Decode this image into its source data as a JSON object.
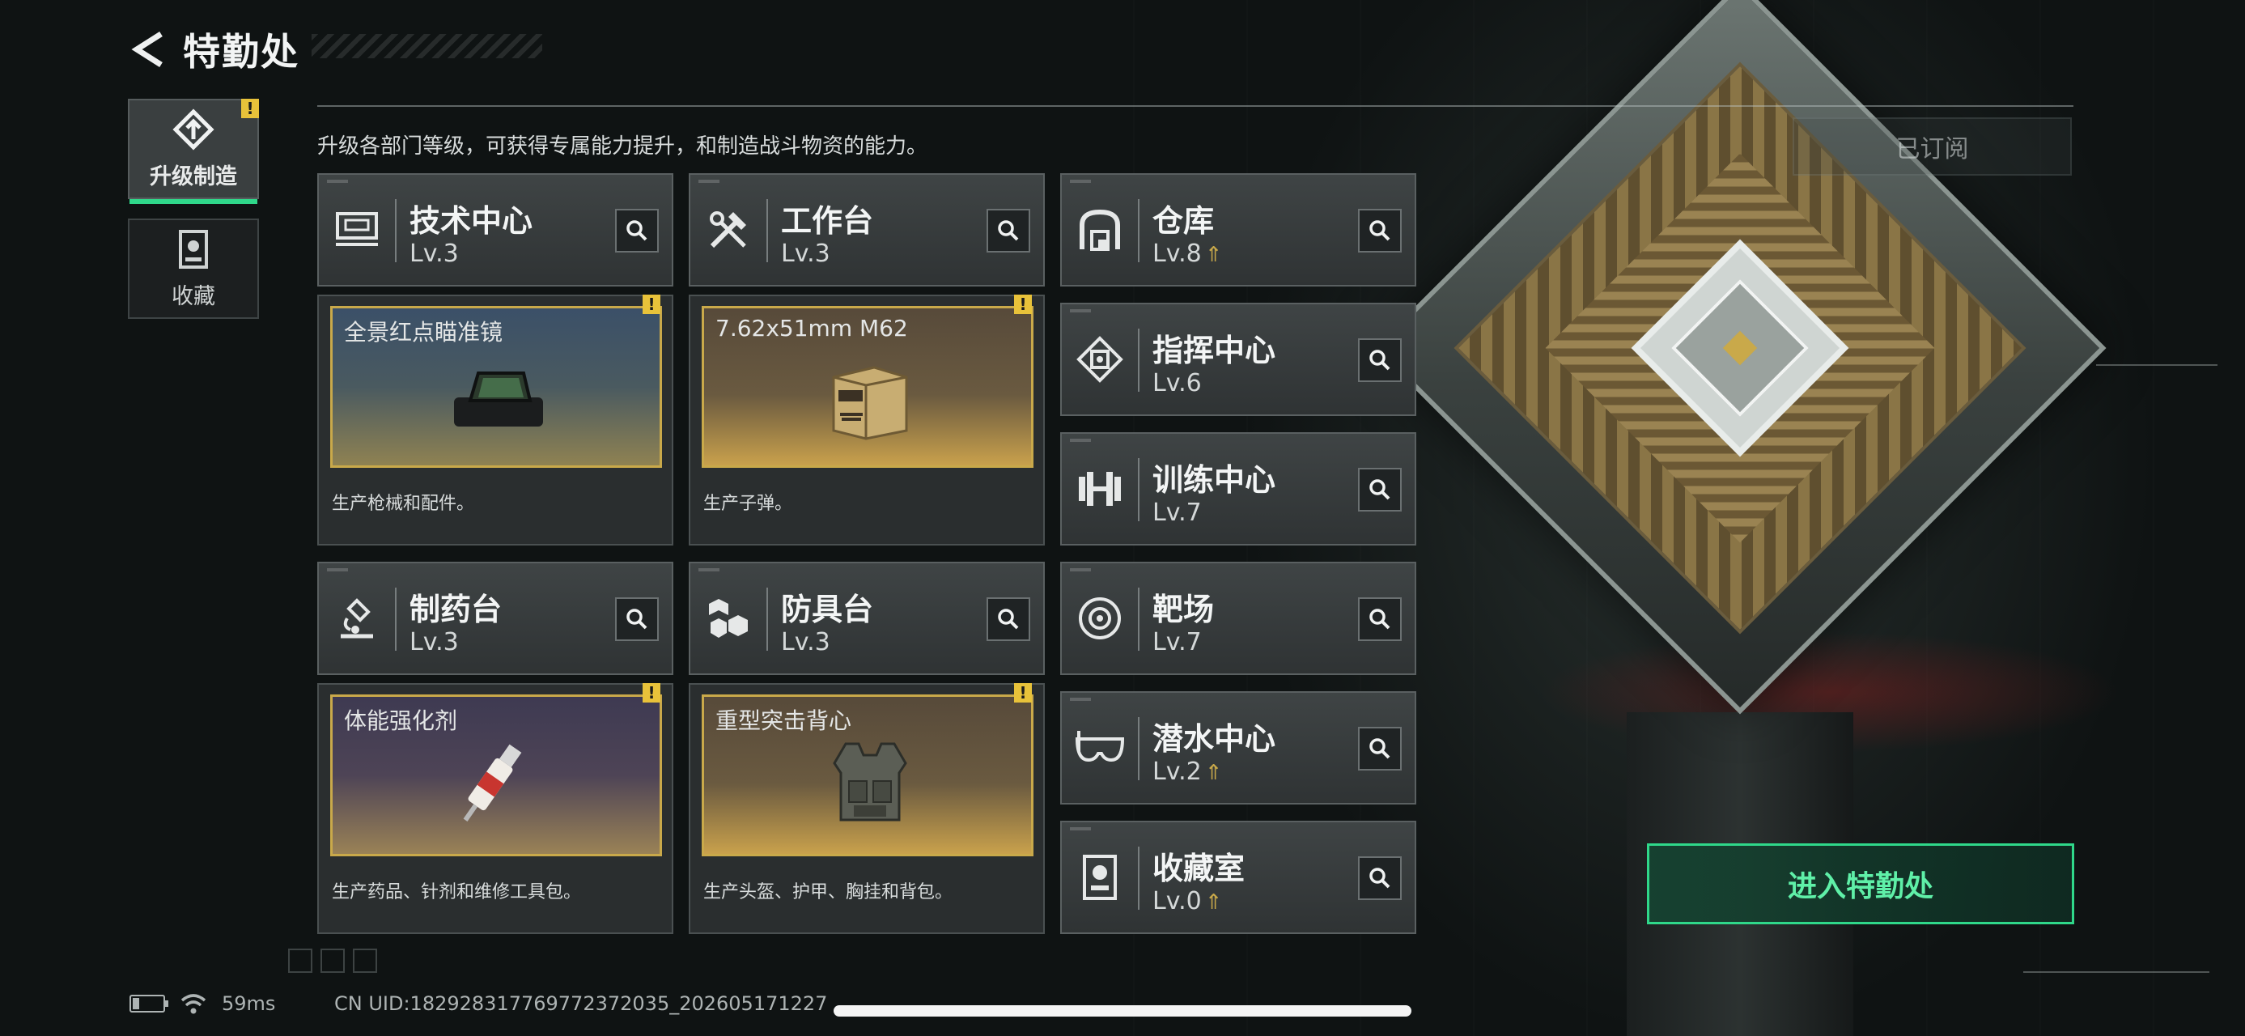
{
  "header": {
    "title": "特勤处"
  },
  "tabs": [
    {
      "label": "升级制造",
      "active": true,
      "alert": "!"
    },
    {
      "label": "收藏",
      "active": false
    }
  ],
  "description": "升级各部门等级，可获得专属能力提升，和制造战斗物资的能力。",
  "subscribe_label": "已订阅",
  "departments": [
    {
      "name": "技术中心",
      "level": "Lv.3",
      "icon": "tech-center-icon"
    },
    {
      "name": "工作台",
      "level": "Lv.3",
      "icon": "workbench-icon"
    },
    {
      "name": "仓库",
      "level": "Lv.8",
      "icon": "warehouse-icon",
      "upgradable": true
    },
    {
      "name": "指挥中心",
      "level": "Lv.6",
      "icon": "command-center-icon"
    },
    {
      "name": "训练中心",
      "level": "Lv.7",
      "icon": "training-center-icon"
    },
    {
      "name": "制药台",
      "level": "Lv.3",
      "icon": "pharmacy-icon"
    },
    {
      "name": "防具台",
      "level": "Lv.3",
      "icon": "armor-bench-icon"
    },
    {
      "name": "靶场",
      "level": "Lv.7",
      "icon": "shooting-range-icon"
    },
    {
      "name": "潜水中心",
      "level": "Lv.2",
      "icon": "diving-center-icon",
      "upgradable": true
    },
    {
      "name": "收藏室",
      "level": "Lv.0",
      "icon": "collection-room-icon",
      "upgradable": true
    }
  ],
  "productions": [
    {
      "item": "全景红点瞄准镜",
      "desc": "生产枪械和配件。",
      "alert": "!"
    },
    {
      "item": "7.62x51mm M62",
      "desc": "生产子弹。",
      "alert": "!"
    },
    {
      "item": "体能强化剂",
      "desc": "生产药品、针剂和维修工具包。",
      "alert": "!"
    },
    {
      "item": "重型突击背心",
      "desc": "生产头盔、护甲、胸挂和背包。",
      "alert": "!"
    }
  ],
  "enter_button": "进入特勤处",
  "status": {
    "ping": "59ms",
    "uid": "CN UID:18292831776977237203​5_202605171227"
  },
  "colors": {
    "accent": "#2fd88a",
    "gold": "#c9a94a",
    "alert": "#e8c23a"
  }
}
